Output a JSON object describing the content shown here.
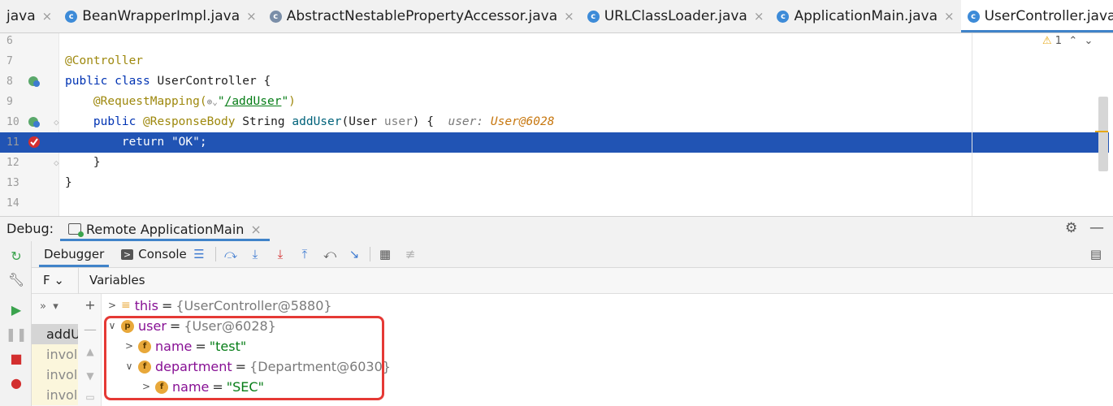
{
  "tabs": [
    {
      "label": "java",
      "icon": "",
      "active": false
    },
    {
      "label": "BeanWrapperImpl.java",
      "icon": "class-icon",
      "active": false
    },
    {
      "label": "AbstractNestablePropertyAccessor.java",
      "icon": "class-icon",
      "active": false
    },
    {
      "label": "URLClassLoader.java",
      "icon": "class-icon",
      "active": false
    },
    {
      "label": "ApplicationMain.java",
      "icon": "class-icon",
      "active": false
    },
    {
      "label": "UserController.java",
      "icon": "class-icon",
      "active": true
    }
  ],
  "tab_close": "×",
  "tab_more": "⌄",
  "editor": {
    "warnings_count": "1",
    "lines": [
      {
        "num": "6"
      },
      {
        "num": "7"
      },
      {
        "num": "8"
      },
      {
        "num": "9"
      },
      {
        "num": "10"
      },
      {
        "num": "11"
      },
      {
        "num": "12"
      },
      {
        "num": "13"
      },
      {
        "num": "14"
      }
    ],
    "code": {
      "l7_ann": "@Controller",
      "l8_kw": "public class",
      "l8_rest": " UserController {",
      "l9_ann": "@RequestMapping(",
      "l9_url": "/addUser",
      "l9_end": "\")",
      "l10_kw": "public ",
      "l10_ann": "@ResponseBody",
      "l10_type": " String ",
      "l10_meth": "addUser",
      "l10_args": "(User ",
      "l10_param": "user",
      "l10_end": ") {",
      "l10_hint": "user: ",
      "l10_hintv": "User@6028",
      "l11_kw": "return ",
      "l11_str": "\"OK\"",
      "l11_end": ";",
      "l12": "}",
      "l13": "}"
    }
  },
  "debug": {
    "title": "Debug:",
    "session_tab": "Remote ApplicationMain",
    "debugger_tab": "Debugger",
    "console_tab": "Console",
    "frames_header": "F",
    "variables_header": "Variables",
    "frames": [
      "addU",
      "invol",
      "invol",
      "invol"
    ],
    "variables": {
      "this": {
        "name": "this",
        "value": "{UserController@5880}"
      },
      "user": {
        "name": "user",
        "value": "{User@6028}",
        "badge": "p"
      },
      "user_name": {
        "name": "name",
        "value": "\"test\"",
        "badge": "f"
      },
      "department": {
        "name": "department",
        "value": "{Department@6030}",
        "badge": "f"
      },
      "department_name": {
        "name": "name",
        "value": "\"SEC\"",
        "badge": "f"
      }
    },
    "eq": "="
  },
  "colors": {
    "highlight_line": "#2154b4",
    "accent": "#4083c9",
    "annotation_box": "#e53935"
  }
}
